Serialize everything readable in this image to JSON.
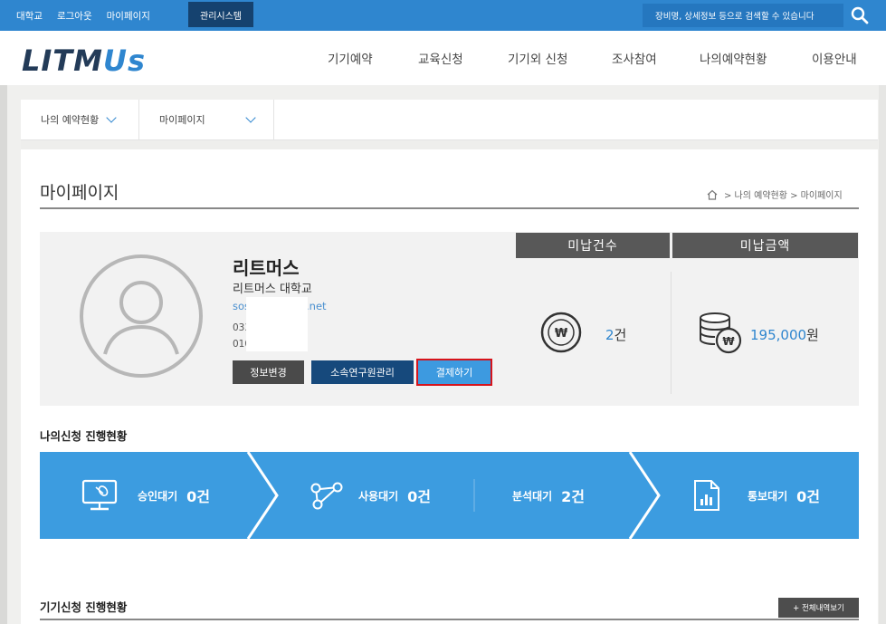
{
  "topbar": {
    "links": [
      "대학교",
      "로그아웃",
      "마이페이지"
    ],
    "admin_label": "관리시스템",
    "search_placeholder": "장비명, 상세정보 등으로 검색할 수 있습니다"
  },
  "header": {
    "logo_main": "LITM",
    "logo_accent": "Us",
    "nav": [
      "기기예약",
      "교육신청",
      "기기외 신청",
      "조사참여",
      "나의예약현황",
      "이용안내"
    ]
  },
  "subnav": {
    "first": "나의 예약현황",
    "second": "마이페이지"
  },
  "page": {
    "title": "마이페이지",
    "breadcrumb": "> 나의 예약현황 > 마이페이지"
  },
  "profile": {
    "name": "리트머스",
    "school": "리트머스 대학교",
    "email_start": "sos",
    "email_end": ".net",
    "phone1": "033",
    "phone2": "010",
    "buttons": {
      "info": "정보변경",
      "lab": "소속연구원관리",
      "pay": "결제하기"
    }
  },
  "stats": {
    "unpaid_count_label": "미납건수",
    "unpaid_amount_label": "미납금액",
    "unpaid_count_value": "2",
    "unpaid_count_unit": "건",
    "unpaid_amount_value": "195,000",
    "unpaid_amount_unit": "원"
  },
  "application_status": {
    "title": "나의신청 진행현황",
    "steps": [
      {
        "label": "승인대기",
        "count": "0건",
        "icon": "monitor-icon"
      },
      {
        "label": "사용대기",
        "count": "0건",
        "icon": "network-icon"
      },
      {
        "label": "분석대기",
        "count": "2건",
        "icon": ""
      },
      {
        "label": "통보대기",
        "count": "0건",
        "icon": "report-icon"
      }
    ]
  },
  "device_status": {
    "title": "기기신청 진행현황",
    "view_all": "+ 전체내역보기"
  },
  "colors": {
    "topbar": "#2f86cf",
    "admin": "#15426f",
    "progress": "#3c9ce0",
    "pay_outline": "#d6141c"
  }
}
